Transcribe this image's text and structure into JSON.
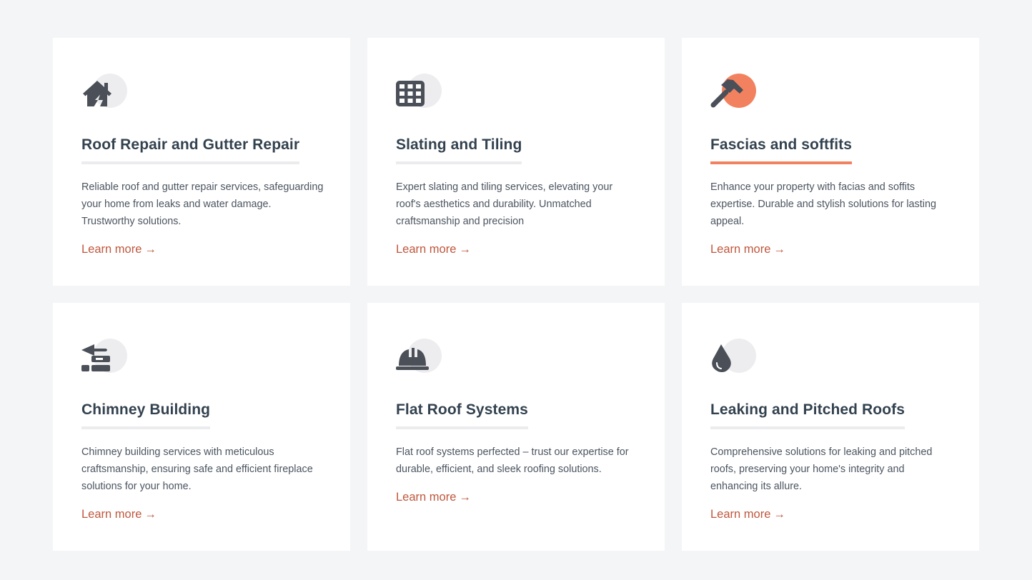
{
  "colors": {
    "page_background": "#f4f5f7",
    "card_background": "#ffffff",
    "title": "#33424f",
    "text": "#4c5560",
    "link": "#c0573d",
    "accent": "#f2825f"
  },
  "services": [
    {
      "icon": "house-damage-icon",
      "title": "Roof Repair and Gutter Repair",
      "description": "Reliable roof and gutter repair services, safeguarding your home from leaks and water damage. Trustworthy solutions.",
      "link_label": "Learn more",
      "link_arrow": "→",
      "active": false
    },
    {
      "icon": "tile-grid-icon",
      "title": "Slating and Tiling",
      "description": "Expert slating and tiling services, elevating your roof's aesthetics and durability. Unmatched craftsmanship and precision",
      "link_label": "Learn more",
      "link_arrow": "→",
      "active": false
    },
    {
      "icon": "hammer-icon",
      "title": "Fascias and softfits",
      "description": "Enhance your property with facias and soffits expertise. Durable and stylish solutions for lasting appeal.",
      "link_label": "Learn more",
      "link_arrow": "→",
      "active": true
    },
    {
      "icon": "trowel-bricks-icon",
      "title": "Chimney Building",
      "description": "Chimney building services with meticulous craftsmanship, ensuring safe and efficient fireplace solutions for your home.",
      "link_label": "Learn more",
      "link_arrow": "→",
      "active": false
    },
    {
      "icon": "hard-hat-icon",
      "title": "Flat Roof Systems",
      "description": "Flat roof systems perfected – trust our expertise for durable, efficient, and sleek roofing solutions.",
      "link_label": "Learn more",
      "link_arrow": "→",
      "active": false
    },
    {
      "icon": "water-drop-icon",
      "title": "Leaking and Pitched Roofs",
      "description": "Comprehensive solutions for leaking and pitched roofs, preserving your home's integrity and enhancing its allure.",
      "link_label": "Learn more",
      "link_arrow": "→",
      "active": false
    }
  ]
}
